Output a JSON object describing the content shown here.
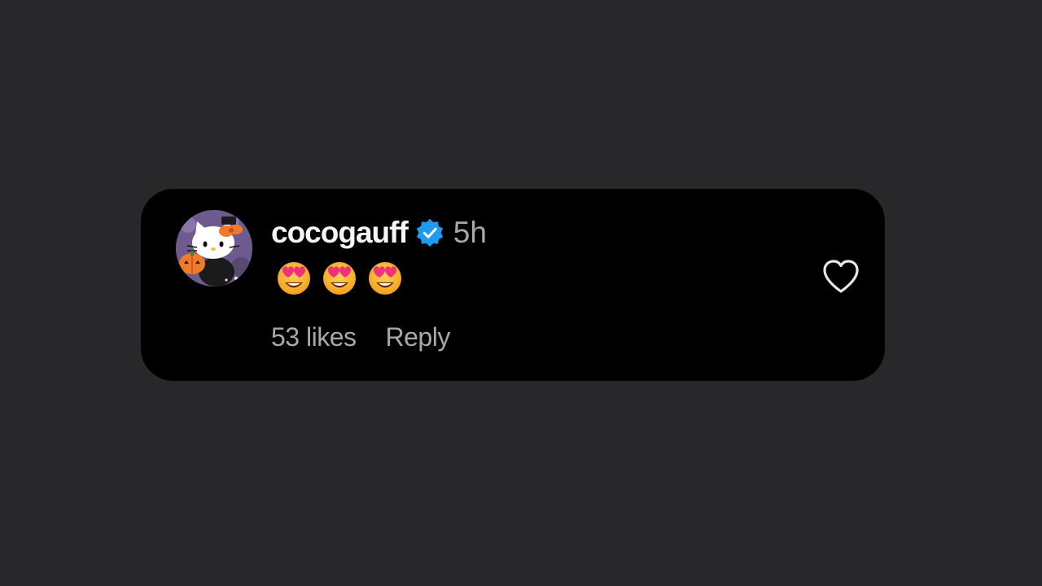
{
  "comment": {
    "username": "cocogauff",
    "verified": true,
    "timestamp": "5h",
    "text": "😍😍😍",
    "likes_label": "53 likes",
    "reply_label": "Reply",
    "avatar_icon": "hello-kitty-avatar",
    "like_icon": "heart-outline-icon",
    "verified_icon": "verified-badge-icon"
  },
  "colors": {
    "page_background": "#28282b",
    "card_background": "#000000",
    "username": "#f5f5f5",
    "secondary_text": "#a8a8a8",
    "verified_blue": "#1d9bf0"
  }
}
